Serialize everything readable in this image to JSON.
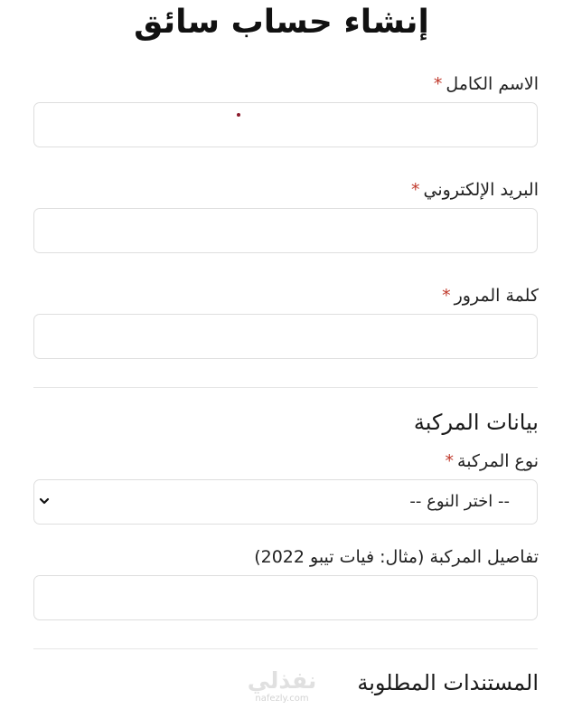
{
  "page_title": "إنشاء حساب سائق",
  "required_marker": "*",
  "fields": {
    "full_name": {
      "label": "الاسم الكامل",
      "value": ""
    },
    "email": {
      "label": "البريد الإلكتروني",
      "value": ""
    },
    "password": {
      "label": "كلمة المرور",
      "value": ""
    }
  },
  "vehicle_section": {
    "title": "بيانات المركبة",
    "vehicle_type": {
      "label": "نوع المركبة",
      "selected": "-- اختر النوع --"
    },
    "vehicle_details": {
      "label": "تفاصيل المركبة (مثال: فيات تيبو 2022)",
      "value": ""
    }
  },
  "documents_section": {
    "title": "المستندات المطلوبة"
  },
  "watermark": {
    "arabic": "نفذلي",
    "latin": "nafezly.com"
  },
  "colors": {
    "required": "#c0392b",
    "border": "#dedede"
  }
}
